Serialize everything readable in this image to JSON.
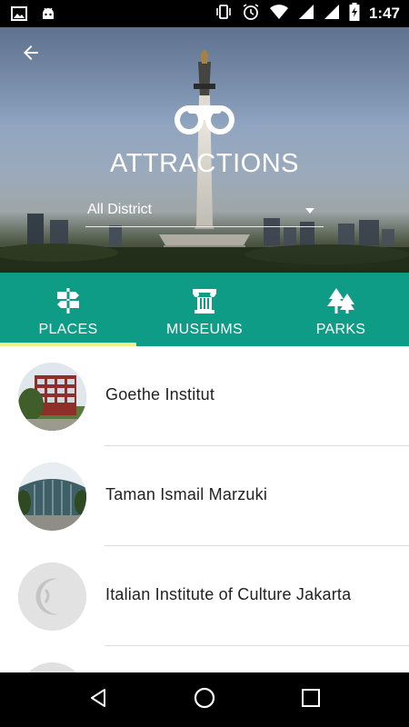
{
  "status_bar": {
    "time": "1:47",
    "left_icons": [
      "image-icon",
      "android-icon"
    ],
    "right_icons": [
      "vibrate-icon",
      "alarm-icon",
      "wifi-icon",
      "signal-icon",
      "signal-icon",
      "battery-charging-icon"
    ]
  },
  "header": {
    "title": "ATTRACTIONS",
    "district_selected": "All District",
    "icon": "binoculars-icon",
    "back_icon": "arrow-back-icon"
  },
  "tabs": [
    {
      "label": "PLACES",
      "icon": "signpost-icon",
      "active": true
    },
    {
      "label": "MUSEUMS",
      "icon": "column-icon",
      "active": false
    },
    {
      "label": "PARKS",
      "icon": "tree-icon",
      "active": false
    }
  ],
  "list": {
    "items": [
      {
        "label": "Goethe Institut",
        "thumbnail": "building-photo"
      },
      {
        "label": "Taman Ismail Marzuki",
        "thumbnail": "building-photo"
      },
      {
        "label": "Italian Institute of Culture Jakarta",
        "thumbnail": "placeholder-logo"
      }
    ]
  },
  "colors": {
    "tab_bar": "#0f9c86",
    "tab_indicator": "#f1f08a"
  },
  "nav_bar": [
    "back-nav-icon",
    "home-nav-icon",
    "recents-nav-icon"
  ]
}
